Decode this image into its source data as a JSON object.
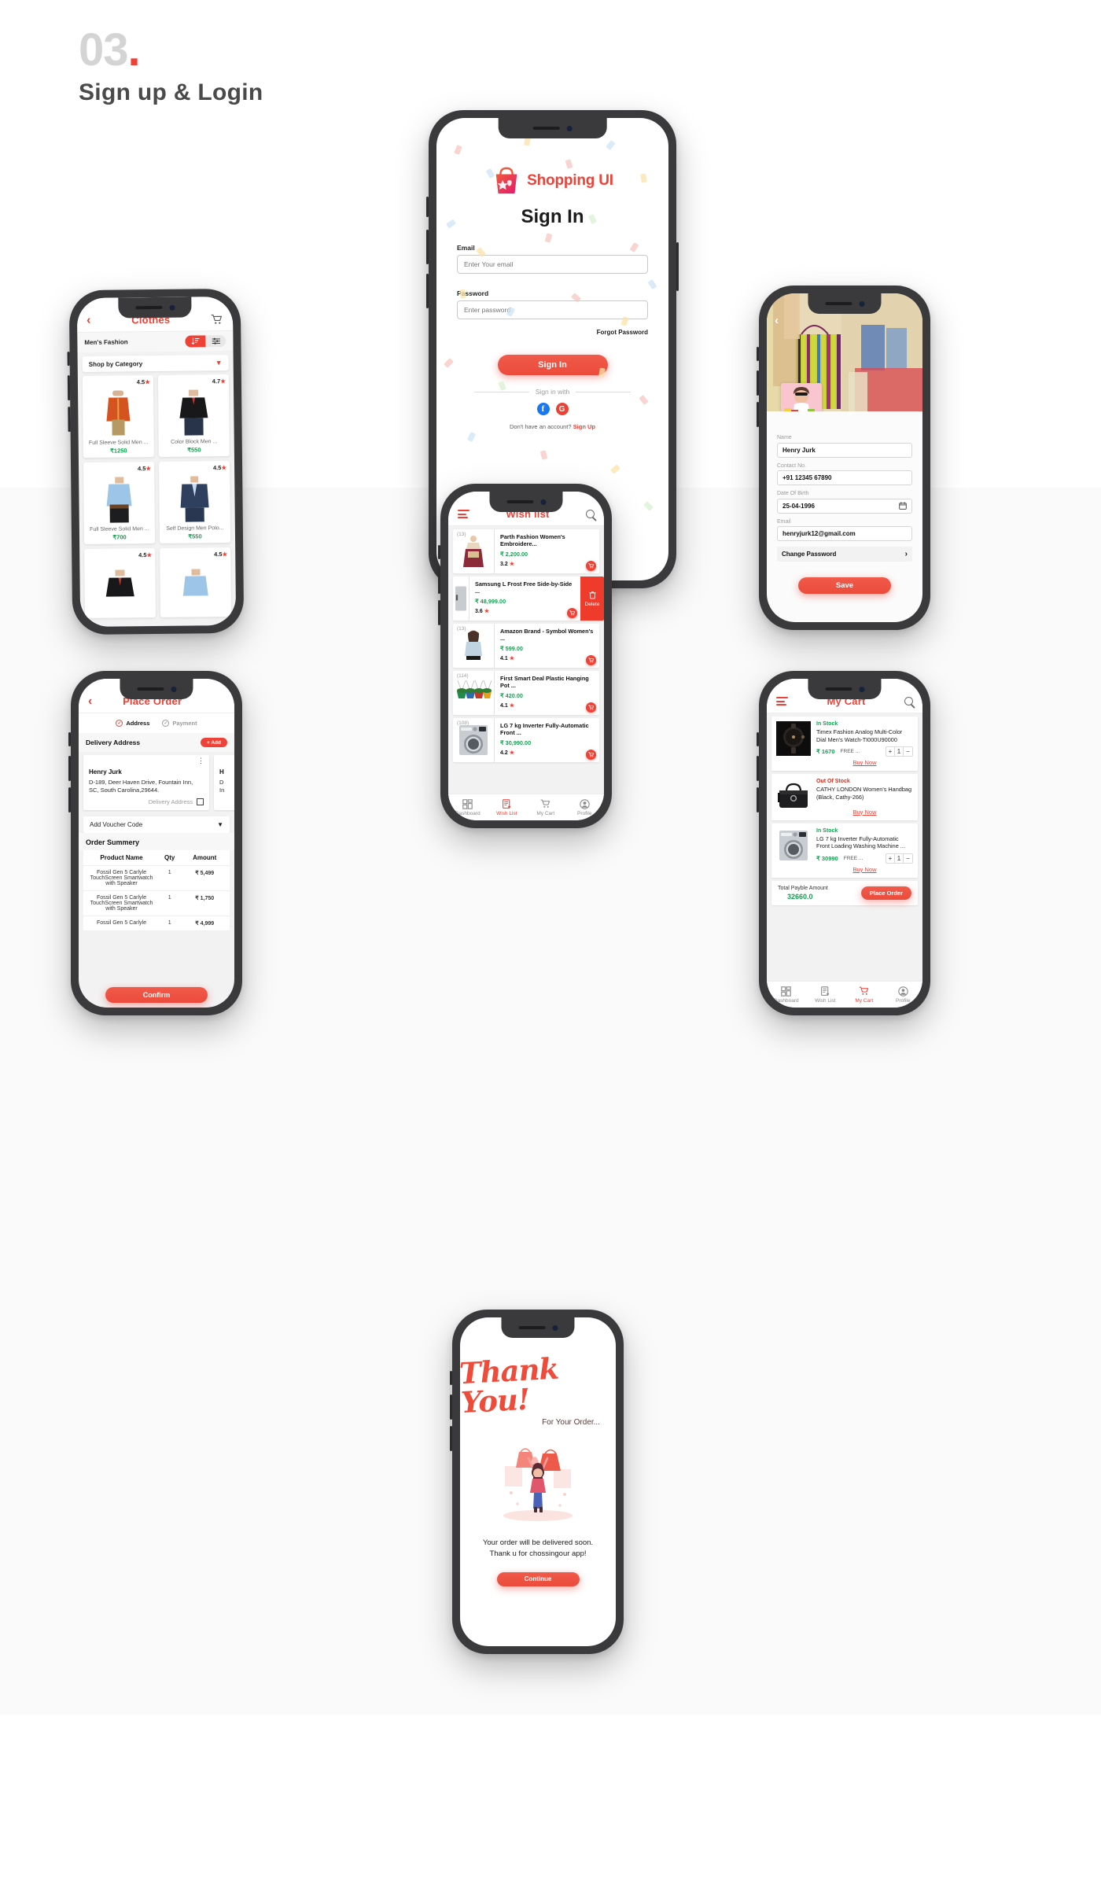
{
  "header": {
    "number": "03",
    "dot": ".",
    "title": "Sign up & Login"
  },
  "theme": {
    "accent": "#EF4136",
    "green": "#12A150",
    "muted": "#9A9A9A"
  },
  "signin": {
    "brand": "Shopping UI",
    "heading": "Sign In",
    "email_label": "Email",
    "email_placeholder": "Enter Your email",
    "password_label": "Password",
    "password_placeholder": "Enter password",
    "forgot": "Forgot Password",
    "submit": "Sign In",
    "divider": "Sign in with",
    "social": [
      {
        "name": "facebook-icon",
        "glyph": "f"
      },
      {
        "name": "google-icon",
        "glyph": "G"
      }
    ],
    "no_account": "Don't have an account?",
    "signup": "Sign Up"
  },
  "clothes": {
    "title": "Clothes",
    "category": "Men's Fashion",
    "shop_by_category": "Shop by Category",
    "products": [
      {
        "name": "Full Sleeve Solid Men ...",
        "price": "₹1250",
        "rating": "4.5"
      },
      {
        "name": "Color Block Men ...",
        "price": "₹550",
        "rating": "4.7"
      },
      {
        "name": "Full Sleeve Solid Men ...",
        "price": "₹700",
        "rating": "4.5"
      },
      {
        "name": "Self Design Men Polo...",
        "price": "₹550",
        "rating": "4.5"
      },
      {
        "name": "",
        "price": "",
        "rating": "4.5"
      },
      {
        "name": "",
        "price": "",
        "rating": "4.5"
      }
    ]
  },
  "profile": {
    "fields": [
      {
        "label": "Name",
        "value": "Henry Jurk"
      },
      {
        "label": "Contact No.",
        "value": "+91 12345 67890"
      },
      {
        "label": "Date Of Birth",
        "value": "25-04-1996"
      },
      {
        "label": "Email",
        "value": "henryjurk12@gmail.com"
      }
    ],
    "change_password": "Change Password",
    "save": "Save"
  },
  "wishlist": {
    "title": "Wish list",
    "delete_label": "Delete",
    "items": [
      {
        "qty": "(13)",
        "name": "Parth Fashion Women's Embroidere...",
        "price": "₹ 2,200.00",
        "rating": "3.2"
      },
      {
        "qty": "",
        "name": "Samsung L Frost Free Side-by-Side ...",
        "price": "₹ 48,999.00",
        "rating": "3.6",
        "swiped": true
      },
      {
        "qty": "(13)",
        "name": "Amazon Brand - Symbol Women's ...",
        "price": "₹ 599.00",
        "rating": "4.1"
      },
      {
        "qty": "(114)",
        "name": "First Smart Deal Plastic Hanging Pot ...",
        "price": "₹ 420.00",
        "rating": "4.1"
      },
      {
        "qty": "(108)",
        "name": "LG 7 kg Inverter Fully-Automatic Front ...",
        "price": "₹ 30,990.00",
        "rating": "4.2"
      }
    ],
    "nav": [
      {
        "label": "Dashboard",
        "icon": "dashboard-icon",
        "active": false
      },
      {
        "label": "Wish List",
        "icon": "wishlist-icon",
        "active": true
      },
      {
        "label": "My Cart",
        "icon": "cart-icon",
        "active": false
      },
      {
        "label": "Profile",
        "icon": "profile-icon",
        "active": false
      }
    ]
  },
  "place_order": {
    "title": "Place Order",
    "steps": [
      {
        "label": "Address",
        "done": true
      },
      {
        "label": "Payment",
        "done": false
      }
    ],
    "delivery_heading": "Delivery Address",
    "add_button": "+ Add",
    "address": {
      "name": "Henry Jurk",
      "line": "D-189,  Deer Haven Drive,  Fountain Inn, SC, South Carolina,29644.",
      "checkbox_label": "Delivery Address"
    },
    "address2": {
      "name": "H",
      "line": "D\nIn"
    },
    "voucher": "Add Voucher Code",
    "summary_title": "Order Summery",
    "table": {
      "columns": [
        "Product Name",
        "Qty",
        "Amount"
      ],
      "rows": [
        [
          "Fossil Gen 5 Carlyle TouchScreen Smartwatch with Speaker",
          "1",
          "₹ 5,499"
        ],
        [
          "Fossil Gen 5 Carlyle TouchScreen Smartwatch with Speaker",
          "1",
          "₹ 1,750"
        ],
        [
          "Fossil Gen 5 Carlyle",
          "1",
          "₹ 4,999"
        ]
      ]
    },
    "confirm": "Confirm"
  },
  "cart": {
    "title": "My Cart",
    "items": [
      {
        "stock": "In Stock",
        "in": true,
        "name": "Timex Fashion Analog Multi-Color Dial Men's Watch-TI000U90000",
        "price": "₹ 1670",
        "free": "FREE ...",
        "qty": "1",
        "buy": "Buy Now",
        "thumb": "watch"
      },
      {
        "stock": "Out Of Stock",
        "in": false,
        "name": "CATHY LONDON Women's Handbag (Black, Cathy-266)",
        "price": "",
        "free": "",
        "qty": "",
        "buy": "Buy Now",
        "thumb": "handbag"
      },
      {
        "stock": "In Stock",
        "in": true,
        "name": "LG 7 kg Inverter Fully-Automatic Front Loading Washing Machine ...",
        "price": "₹ 30990",
        "free": "FREE ...",
        "qty": "1",
        "buy": "Buy Now",
        "thumb": "washer"
      }
    ],
    "total_label": "Total Payble Amount",
    "total_value": "32660.0",
    "place_order": "Place Order",
    "nav": [
      {
        "label": "Dashboard",
        "icon": "dashboard-icon",
        "active": false
      },
      {
        "label": "Wish List",
        "icon": "wishlist-icon",
        "active": false
      },
      {
        "label": "My Cart",
        "icon": "cart-icon",
        "active": true
      },
      {
        "label": "Profile",
        "icon": "profile-icon",
        "active": false
      }
    ]
  },
  "thanks": {
    "title": "Thank You!",
    "subtitle": "For Your Order...",
    "message_line1": "Your order will be delivered soon.",
    "message_line2": "Thank u for chossingour app!",
    "continue": "Continue"
  }
}
